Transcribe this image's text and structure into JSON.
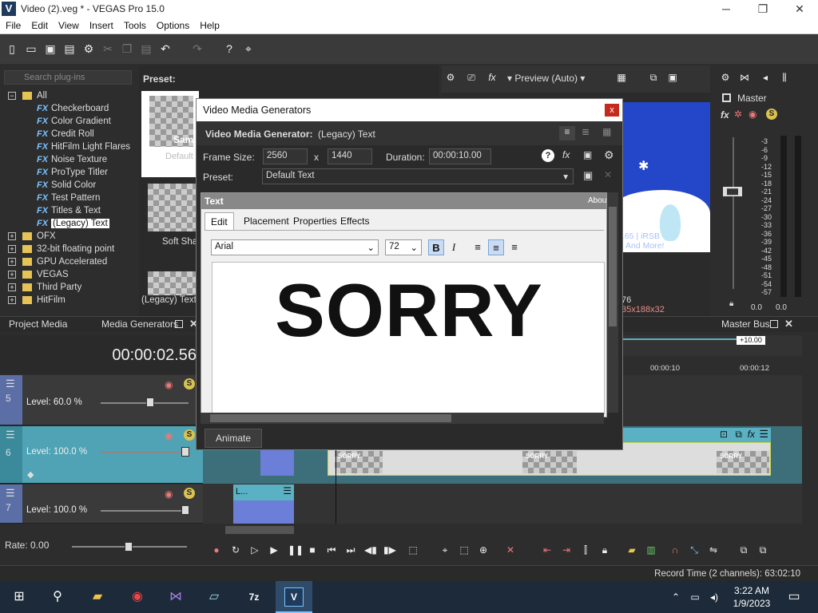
{
  "window": {
    "title": "Video (2).veg * - VEGAS Pro 15.0",
    "icon": "V",
    "minimize": "─",
    "maximize": "❐",
    "close": "✕"
  },
  "menu": [
    "File",
    "Edit",
    "View",
    "Insert",
    "Tools",
    "Options",
    "Help"
  ],
  "plugins": {
    "search_placeholder": "Search plug-ins",
    "tree": [
      {
        "label": "All",
        "type": "folder",
        "expanded": true
      },
      {
        "label": "Checkerboard",
        "type": "fx"
      },
      {
        "label": "Color Gradient",
        "type": "fx"
      },
      {
        "label": "Credit Roll",
        "type": "fx"
      },
      {
        "label": "HitFilm Light Flares",
        "type": "fx"
      },
      {
        "label": "Noise Texture",
        "type": "fx"
      },
      {
        "label": "ProType Titler",
        "type": "fx"
      },
      {
        "label": "Solid Color",
        "type": "fx"
      },
      {
        "label": "Test Pattern",
        "type": "fx"
      },
      {
        "label": "Titles & Text",
        "type": "fx"
      },
      {
        "label": "(Legacy) Text",
        "type": "fx",
        "selected": true
      },
      {
        "label": "OFX",
        "type": "folder"
      },
      {
        "label": "32-bit floating point",
        "type": "folder"
      },
      {
        "label": "GPU Accelerated",
        "type": "folder"
      },
      {
        "label": "VEGAS",
        "type": "folder"
      },
      {
        "label": "Third Party",
        "type": "folder"
      },
      {
        "label": "HitFilm",
        "type": "folder"
      }
    ]
  },
  "preset_panel": {
    "label": "Preset:",
    "items": [
      "Default",
      "Soft Sha",
      "(Legacy) Text"
    ],
    "thumb_text": "Samp Text"
  },
  "preview": {
    "label": "Preview (Auto)",
    "info1": "76",
    "info2": "35x188x32",
    "overlay1": "165 | iRSB",
    "overlay2": "And More!"
  },
  "master": {
    "label": "Master",
    "scale": [
      "3",
      "6",
      "9",
      "12",
      "15",
      "18",
      "21",
      "24",
      "27",
      "30",
      "33",
      "36",
      "39",
      "42",
      "45",
      "48",
      "51",
      "54",
      "57"
    ],
    "left_value": "0.0",
    "right_value": "0.0"
  },
  "tabs": {
    "project_media": "Project Media",
    "media_generators": "Media Generators",
    "master_bus": "Master Bus"
  },
  "timeline": {
    "timecode": "00:00:02.56",
    "ruler": [
      "00:00:10",
      "00:00:12"
    ],
    "zoom_badge": "+10.00",
    "tracks": [
      {
        "number": "5",
        "level": "Level:   60.0 %",
        "level_value": 60
      },
      {
        "number": "6",
        "level": "Level: 100.0 %",
        "level_value": 100
      },
      {
        "number": "7",
        "level": "Level: 100.0 %",
        "level_value": 100
      }
    ],
    "clip_label": "SORRY",
    "small_clip_label": "L..."
  },
  "transport": {
    "rate": "Rate: 0.00"
  },
  "status": {
    "record_time": "Record Time (2 channels): 63:02:10"
  },
  "taskbar": {
    "time": "3:22 AM",
    "date": "1/9/2023"
  },
  "dialog": {
    "title": "Video Media Generators",
    "close": "x",
    "generator_label": "Video Media Generator:",
    "generator_name": "(Legacy) Text",
    "frame_size_label": "Frame Size:",
    "frame_width": "2560",
    "frame_x": "x",
    "frame_height": "1440",
    "duration_label": "Duration:",
    "duration": "00:00:10.00",
    "preset_label": "Preset:",
    "preset_value": "Default Text",
    "panel_title": "Text",
    "about": "About",
    "tabs": [
      "Edit",
      "Placement",
      "Properties",
      "Effects"
    ],
    "font": "Arial",
    "font_size": "72",
    "bold": "B",
    "italic": "I",
    "content": "SORRY",
    "animate": "Animate"
  }
}
